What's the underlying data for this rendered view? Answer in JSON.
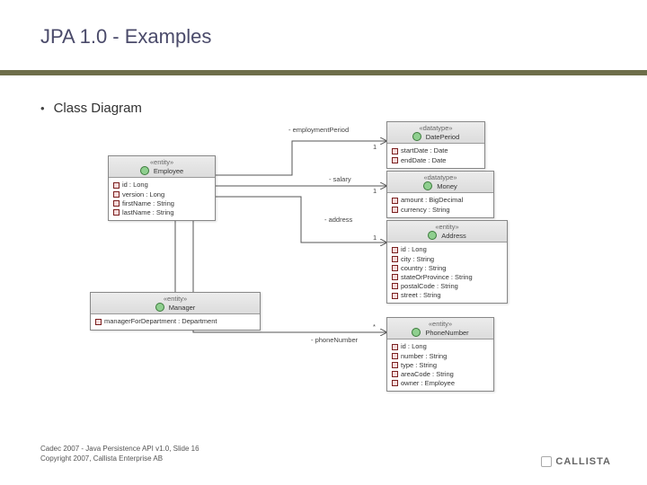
{
  "slide": {
    "title": "JPA 1.0 - Examples",
    "bullet": "Class Diagram",
    "footer_line1": "Cadec 2007 - Java Persistence API v1.0, Slide 16",
    "footer_line2": "Copyright 2007, Callista Enterprise AB",
    "logo_text": "CALLISTA"
  },
  "entities": {
    "employee": {
      "stereo": "«entity»",
      "name": "Employee",
      "attrs": [
        "id : Long",
        "version : Long",
        "firstName : String",
        "lastName : String"
      ]
    },
    "manager": {
      "stereo": "«entity»",
      "name": "Manager",
      "attrs": [
        "managerForDepartment : Department"
      ]
    },
    "dateperiod": {
      "stereo": "«datatype»",
      "name": "DatePeriod",
      "attrs": [
        "startDate : Date",
        "endDate : Date"
      ]
    },
    "money": {
      "stereo": "«datatype»",
      "name": "Money",
      "attrs": [
        "amount : BigDecimal",
        "currency : String"
      ]
    },
    "address": {
      "stereo": "«entity»",
      "name": "Address",
      "attrs": [
        "id : Long",
        "city : String",
        "country : String",
        "stateOrProvince : String",
        "postalCode : String",
        "street : String"
      ]
    },
    "phone": {
      "stereo": "«entity»",
      "name": "PhoneNumber",
      "attrs": [
        "id : Long",
        "number : String",
        "type : String",
        "areaCode : String",
        "owner : Employee"
      ]
    }
  },
  "associations": {
    "employmentPeriod": {
      "label": "- employmentPeriod",
      "mult": "1"
    },
    "salary": {
      "label": "- salary",
      "mult": "1"
    },
    "address": {
      "label": "- address",
      "mult": "1"
    },
    "phoneNumber": {
      "label": "- phoneNumber",
      "mult": "*"
    }
  }
}
